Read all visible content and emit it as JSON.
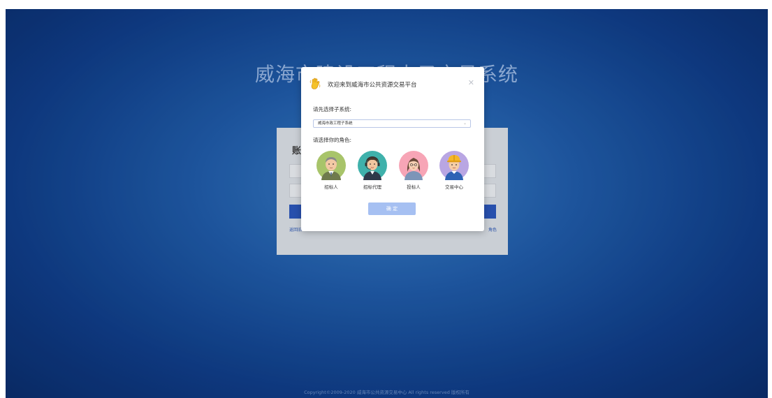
{
  "background": {
    "title": "威海市建设工程电子交易系统",
    "footer": "Copyright©2009-2020 威海市公共资源交易中心 All rights reserved 版权所有"
  },
  "login": {
    "heading": "账号",
    "link_left": "返回旧",
    "link_right": "角色"
  },
  "modal": {
    "title": "欢迎来到威海市公共资源交易平台",
    "subsystem_label": "请先选择子系统:",
    "subsystem_selected": "威海市政工程子系统",
    "role_label": "请选择你的角色:",
    "roles": [
      {
        "label": "招标人",
        "icon": "tenderer-avatar-icon"
      },
      {
        "label": "招标代理",
        "icon": "agent-avatar-icon"
      },
      {
        "label": "投标人",
        "icon": "bidder-avatar-icon"
      },
      {
        "label": "交易中心",
        "icon": "trading-center-avatar-icon"
      }
    ],
    "confirm_label": "确 定"
  },
  "colors": {
    "accent": "#2b56b8",
    "confirm_button": "#a6c0f2",
    "role_bg": [
      "#a8c46a",
      "#3fb1ab",
      "#f7a5b6",
      "#b9a6e3"
    ]
  }
}
